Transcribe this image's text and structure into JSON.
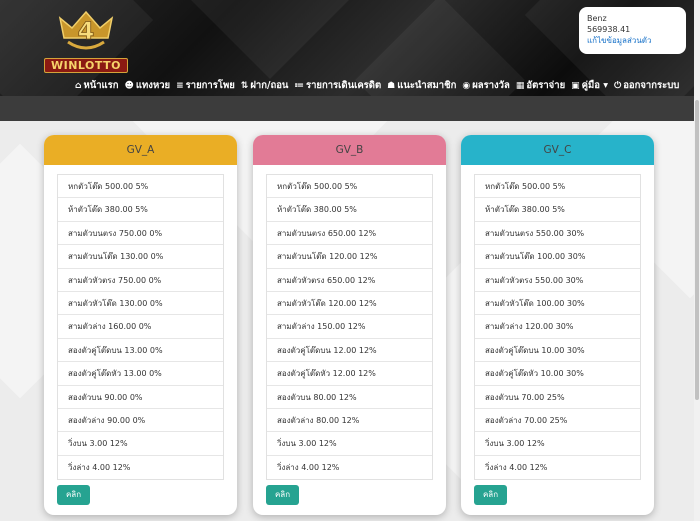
{
  "user": {
    "name": "Benz",
    "credit": "569938.41",
    "edit_link": "แก้ไขข้อมูลส่วนตัว"
  },
  "brand": {
    "logo_text": "WINLOTTO",
    "logo_number": "4"
  },
  "nav": [
    {
      "icon": "home-icon",
      "glyph": "⌂",
      "label": "หน้าแรก"
    },
    {
      "icon": "smile-icon",
      "glyph": "☻",
      "label": "แทงหวย"
    },
    {
      "icon": "list-icon",
      "glyph": "≡",
      "label": "รายการโพย"
    },
    {
      "icon": "transfer-icon",
      "glyph": "⇅",
      "label": "ฝาก/ถอน"
    },
    {
      "icon": "list-alt-icon",
      "glyph": "≔",
      "label": "รายการเดินเครดิต"
    },
    {
      "icon": "users-icon",
      "glyph": "☗",
      "label": "แนะนำสมาชิก"
    },
    {
      "icon": "eye-icon",
      "glyph": "◉",
      "label": "ผลรางวัล"
    },
    {
      "icon": "table-icon",
      "glyph": "▦",
      "label": "อัตราจ่าย"
    },
    {
      "icon": "book-icon",
      "glyph": "▣",
      "label": "คู่มือ ▾"
    },
    {
      "icon": "power-icon",
      "glyph": "⏻",
      "label": "ออกจากระบบ"
    }
  ],
  "colors": {
    "gv_a": "#eaae25",
    "gv_b": "#e27b96",
    "gv_c": "#27b3ca",
    "button": "#26a391"
  },
  "cards": [
    {
      "title": "GV_A",
      "button_label": "คลิก",
      "rates": [
        "หกตัวโต๊ด 500.00 5%",
        "ห้าตัวโต๊ด 380.00 5%",
        "สามตัวบนตรง 750.00 0%",
        "สามตัวบนโต๊ด 130.00 0%",
        "สามตัวหัวตรง 750.00 0%",
        "สามตัวหัวโต๊ด 130.00 0%",
        "สามตัวล่าง 160.00 0%",
        "สองตัวคู่โต๊ดบน 13.00 0%",
        "สองตัวคู่โต๊ดหัว 13.00 0%",
        "สองตัวบน 90.00 0%",
        "สองตัวล่าง 90.00 0%",
        "วิ่งบน 3.00 12%",
        "วิ่งล่าง 4.00 12%"
      ]
    },
    {
      "title": "GV_B",
      "button_label": "คลิก",
      "rates": [
        "หกตัวโต๊ด 500.00 5%",
        "ห้าตัวโต๊ด 380.00 5%",
        "สามตัวบนตรง 650.00 12%",
        "สามตัวบนโต๊ด 120.00 12%",
        "สามตัวหัวตรง 650.00 12%",
        "สามตัวหัวโต๊ด 120.00 12%",
        "สามตัวล่าง 150.00 12%",
        "สองตัวคู่โต๊ดบน 12.00 12%",
        "สองตัวคู่โต๊ดหัว 12.00 12%",
        "สองตัวบน 80.00 12%",
        "สองตัวล่าง 80.00 12%",
        "วิ่งบน 3.00 12%",
        "วิ่งล่าง 4.00 12%"
      ]
    },
    {
      "title": "GV_C",
      "button_label": "คลิก",
      "rates": [
        "หกตัวโต๊ด 500.00 5%",
        "ห้าตัวโต๊ด 380.00 5%",
        "สามตัวบนตรง 550.00 30%",
        "สามตัวบนโต๊ด 100.00 30%",
        "สามตัวหัวตรง 550.00 30%",
        "สามตัวหัวโต๊ด 100.00 30%",
        "สามตัวล่าง 120.00 30%",
        "สองตัวคู่โต๊ดบน 10.00 30%",
        "สองตัวคู่โต๊ดหัว 10.00 30%",
        "สองตัวบน 70.00 25%",
        "สองตัวล่าง 70.00 25%",
        "วิ่งบน 3.00 12%",
        "วิ่งล่าง 4.00 12%"
      ]
    }
  ]
}
